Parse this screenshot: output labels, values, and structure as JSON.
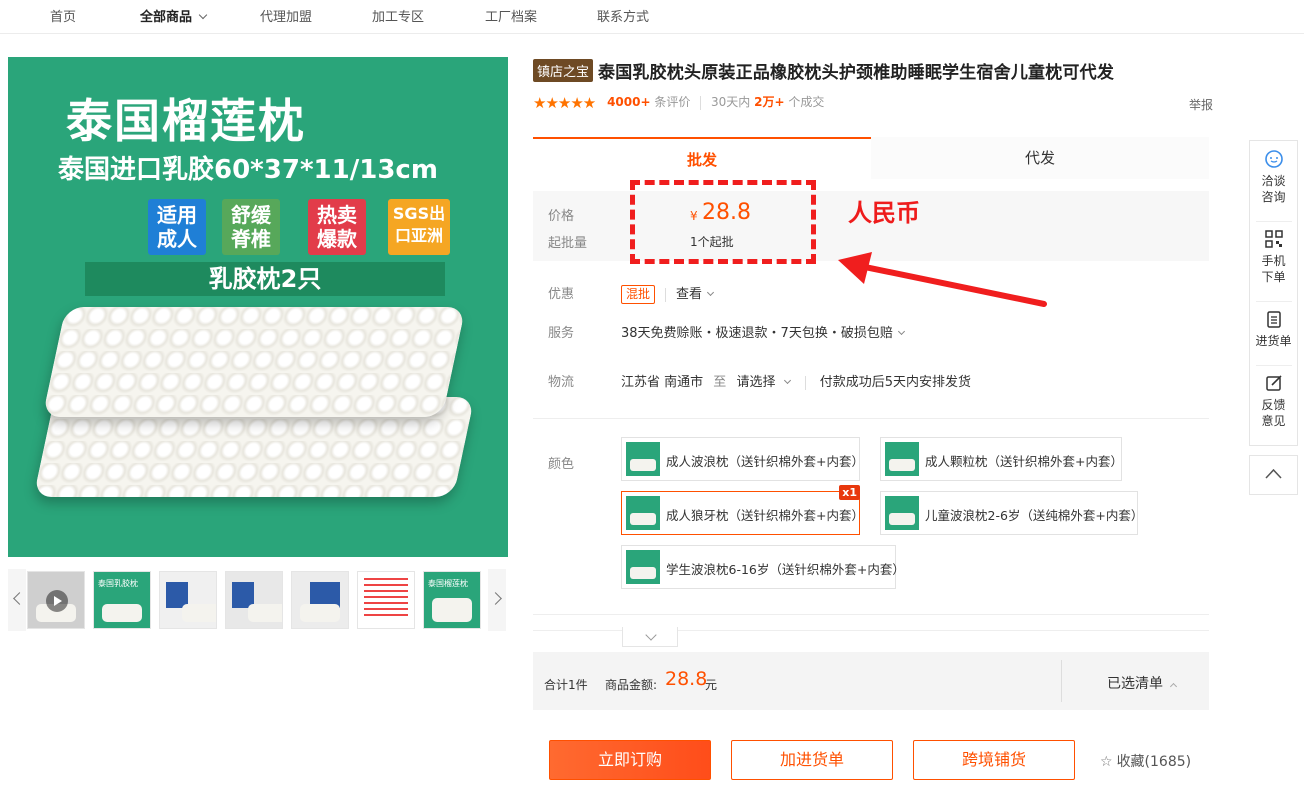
{
  "nav": {
    "items": [
      "首页",
      "全部商品",
      "代理加盟",
      "加工专区",
      "工厂档案",
      "联系方式"
    ]
  },
  "gallery": {
    "main_title": "泰国榴莲枕",
    "main_subtitle": "泰国进口乳胶60*37*11/13cm",
    "tags": [
      {
        "text": "适用成人",
        "color": "#1f7fd6"
      },
      {
        "text": "舒缓脊椎",
        "color": "#57a85a"
      },
      {
        "text": "热卖爆款",
        "color": "#e23c4a"
      },
      {
        "text": "SGS出口亚洲",
        "color": "#f5a623"
      }
    ],
    "banner": "乳胶枕2只",
    "thumb_texts": [
      "泰国乳胶枕",
      "泰国榴莲枕"
    ]
  },
  "product": {
    "badge": "镇店之宝",
    "title": "泰国乳胶枕头原装正品橡胶枕头护颈椎助睡眠学生宿舍儿童枕可代发",
    "stars": "★★★★★",
    "reviews_count": "4000+",
    "reviews_label": "条评价",
    "period": "30天内",
    "sold_count": "2万+",
    "sold_label": "个成交",
    "report": "举报"
  },
  "tabs": {
    "wholesale": "批发",
    "dropship": "代发"
  },
  "price": {
    "price_label": "价格",
    "moq_label": "起批量",
    "currency": "¥",
    "value": "28.8",
    "moq": "1个起批"
  },
  "annotation": {
    "text": "人民币"
  },
  "promo": {
    "label": "优惠",
    "tag": "混批",
    "view": "查看"
  },
  "service": {
    "label": "服务",
    "text": "38天免费赊账・极速退款・7天包换・破损包赔"
  },
  "logistics": {
    "label": "物流",
    "origin": "江苏省 南通市",
    "to": "至",
    "destination": "请选择",
    "note": "付款成功后5天内安排发货"
  },
  "color": {
    "label": "颜色",
    "options": [
      {
        "text": "成人波浪枕（送针织棉外套+内套）"
      },
      {
        "text": "成人颗粒枕（送针织棉外套+内套）"
      },
      {
        "text": "成人狼牙枕（送针织棉外套+内套）",
        "qty": "x1"
      },
      {
        "text": "儿童波浪枕2-6岁（送纯棉外套+内套）"
      },
      {
        "text": "学生波浪枕6-16岁（送针织棉外套+内套）"
      }
    ]
  },
  "summary": {
    "total_items": "合计1件",
    "amount_label": "商品金额:",
    "amount": "28.8",
    "unit": "元",
    "selected_list": "已选清单"
  },
  "buttons": {
    "buy_now": "立即订购",
    "add_cart": "加进货单",
    "cross_border": "跨境铺货",
    "favorite": "收藏(1685)"
  },
  "sidebar": {
    "chat": [
      "洽谈",
      "咨询"
    ],
    "mobile": [
      "手机",
      "下单"
    ],
    "cart": [
      "进货单"
    ],
    "feedback": [
      "反馈",
      "意见"
    ]
  },
  "colors": {
    "accent": "#ff5000",
    "annotation_red": "#f01e1e",
    "product_green": "#2aa57a",
    "badge_brown": "#6e4a24"
  }
}
